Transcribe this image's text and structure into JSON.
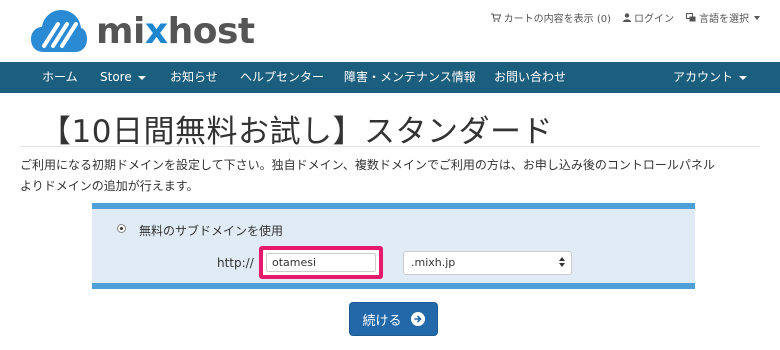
{
  "brand": {
    "name_prefix": "mi",
    "name_x": "x",
    "name_suffix": "host"
  },
  "top_links": {
    "cart": "カートの内容を表示 (0)",
    "login": "ログイン",
    "language": "言語を選択"
  },
  "nav": {
    "items": [
      {
        "label": "ホーム"
      },
      {
        "label": "Store"
      },
      {
        "label": "お知らせ"
      },
      {
        "label": "ヘルプセンター"
      },
      {
        "label": "障害・メンテナンス情報"
      },
      {
        "label": "お問い合わせ"
      }
    ],
    "account": "アカウント"
  },
  "page": {
    "title": "【10日間無料お試し】スタンダード",
    "description_line1": "ご利用になる初期ドメインを設定して下さい。独自ドメイン、複数ドメインでご利用の方は、お申し込み後のコントロールパネル",
    "description_line2": "よりドメインの追加が行えます。"
  },
  "form": {
    "radio_label": "無料のサブドメインを使用",
    "radio_selected": true,
    "protocol_label": "http://",
    "subdomain_value": "otamesi",
    "tld_selected": ".mixh.jp",
    "continue_label": "続ける"
  },
  "colors": {
    "nav_bg": "#1c5e7e",
    "panel_bg": "#e1ebf5",
    "panel_border": "#4f9fd9",
    "highlight": "#e6196d",
    "button_bg": "#2369a9",
    "brand_blue": "#1f86d0"
  }
}
